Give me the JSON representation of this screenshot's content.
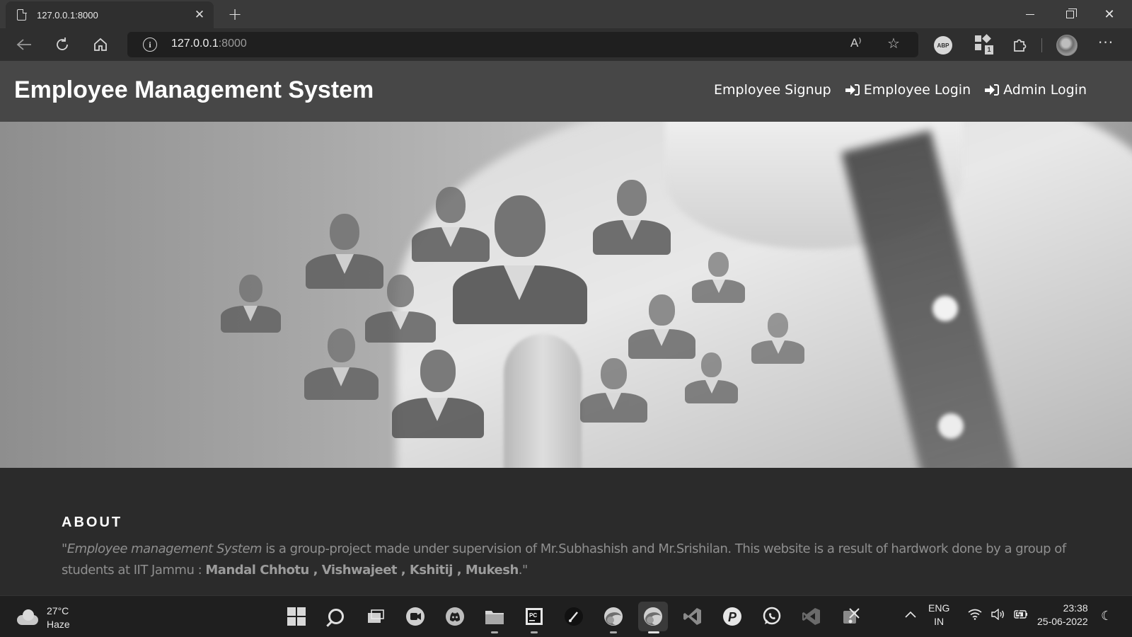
{
  "browser": {
    "tab_title": "127.0.0.1:8000",
    "tab_close": "✕",
    "new_tab": "+",
    "url_host": "127.0.0.1",
    "url_port": ":8000",
    "read_aloud": "A⁾",
    "abp_label": "ABP",
    "collections_badge": "1",
    "more": "···"
  },
  "site": {
    "title": "Employee Management System",
    "nav": {
      "signup": "Employee Signup",
      "employee_login": "Employee Login",
      "admin_login": "Admin Login"
    }
  },
  "about": {
    "heading": "ABOUT",
    "quote_open": "\"",
    "italic": "Employee management System",
    "text": " is a group-project made under supervision of Mr.Subhashish and Mr.Srishilan. This website is a result of hardwork done by a group of students at IIT Jammu : ",
    "members": "Mandal Chhotu , Vishwajeet , Kshitij , Mukesh",
    "quote_close": ".\""
  },
  "taskbar": {
    "temperature": "27°C",
    "weather": "Haze",
    "lang_top": "ENG",
    "lang_bottom": "IN",
    "time": "23:38",
    "date": "25-06-2022"
  }
}
